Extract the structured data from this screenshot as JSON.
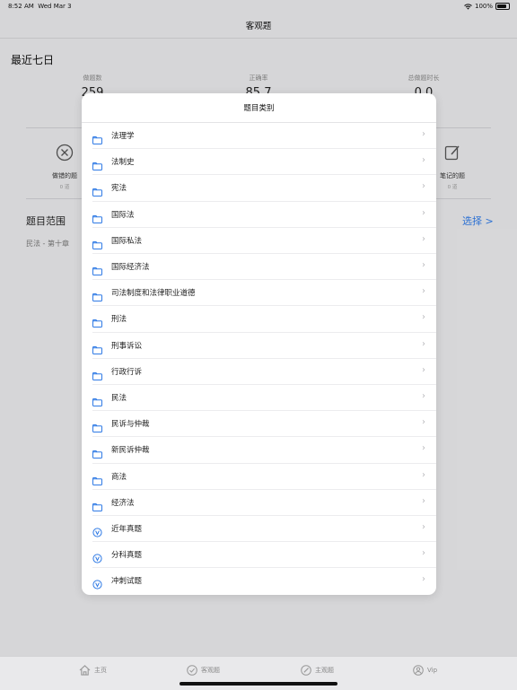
{
  "status_bar": {
    "time": "8:52 AM",
    "date": "Wed Mar 3",
    "battery": "100%"
  },
  "nav": {
    "title": "客观题"
  },
  "background": {
    "section_title": "最近七日",
    "stats": [
      {
        "label": "做题数",
        "value": "259"
      },
      {
        "label": "正确率",
        "value": "85.7"
      },
      {
        "label": "总做题时长",
        "value": "0.0"
      }
    ],
    "wrong": {
      "label": "做错的题",
      "count": "0 道"
    },
    "notes": {
      "label": "笔记的题",
      "count": "0 道"
    },
    "range_title": "题目范围",
    "range_value": "民法 - 第十章 ",
    "select_label": "选择 >"
  },
  "modal": {
    "title": "题目类别",
    "items": [
      {
        "label": "法理学",
        "icon": "folder-icon"
      },
      {
        "label": "法制史",
        "icon": "folder-icon"
      },
      {
        "label": "宪法",
        "icon": "folder-icon"
      },
      {
        "label": "国际法",
        "icon": "folder-icon"
      },
      {
        "label": "国际私法",
        "icon": "folder-icon"
      },
      {
        "label": "国际经济法",
        "icon": "folder-icon"
      },
      {
        "label": "司法制度和法律职业道德",
        "icon": "folder-icon"
      },
      {
        "label": "刑法",
        "icon": "folder-icon"
      },
      {
        "label": "刑事诉讼",
        "icon": "folder-icon"
      },
      {
        "label": "行政行诉",
        "icon": "folder-icon"
      },
      {
        "label": "民法",
        "icon": "folder-icon"
      },
      {
        "label": "民诉与仲裁",
        "icon": "folder-icon"
      },
      {
        "label": "新民诉仲裁",
        "icon": "folder-icon"
      },
      {
        "label": "商法",
        "icon": "folder-icon"
      },
      {
        "label": "经济法",
        "icon": "folder-icon"
      },
      {
        "label": "近年真题",
        "icon": "vip-icon"
      },
      {
        "label": "分科真题",
        "icon": "vip-icon"
      },
      {
        "label": "冲刺试题",
        "icon": "vip-icon"
      }
    ]
  },
  "tabs": [
    {
      "label": "主页",
      "icon": "home-icon"
    },
    {
      "label": "客观题",
      "icon": "check-circle-icon"
    },
    {
      "label": "主观题",
      "icon": "pen-circle-icon"
    },
    {
      "label": "Vip",
      "icon": "user-circle-icon"
    }
  ],
  "colors": {
    "accent": "#2f7ae5"
  }
}
